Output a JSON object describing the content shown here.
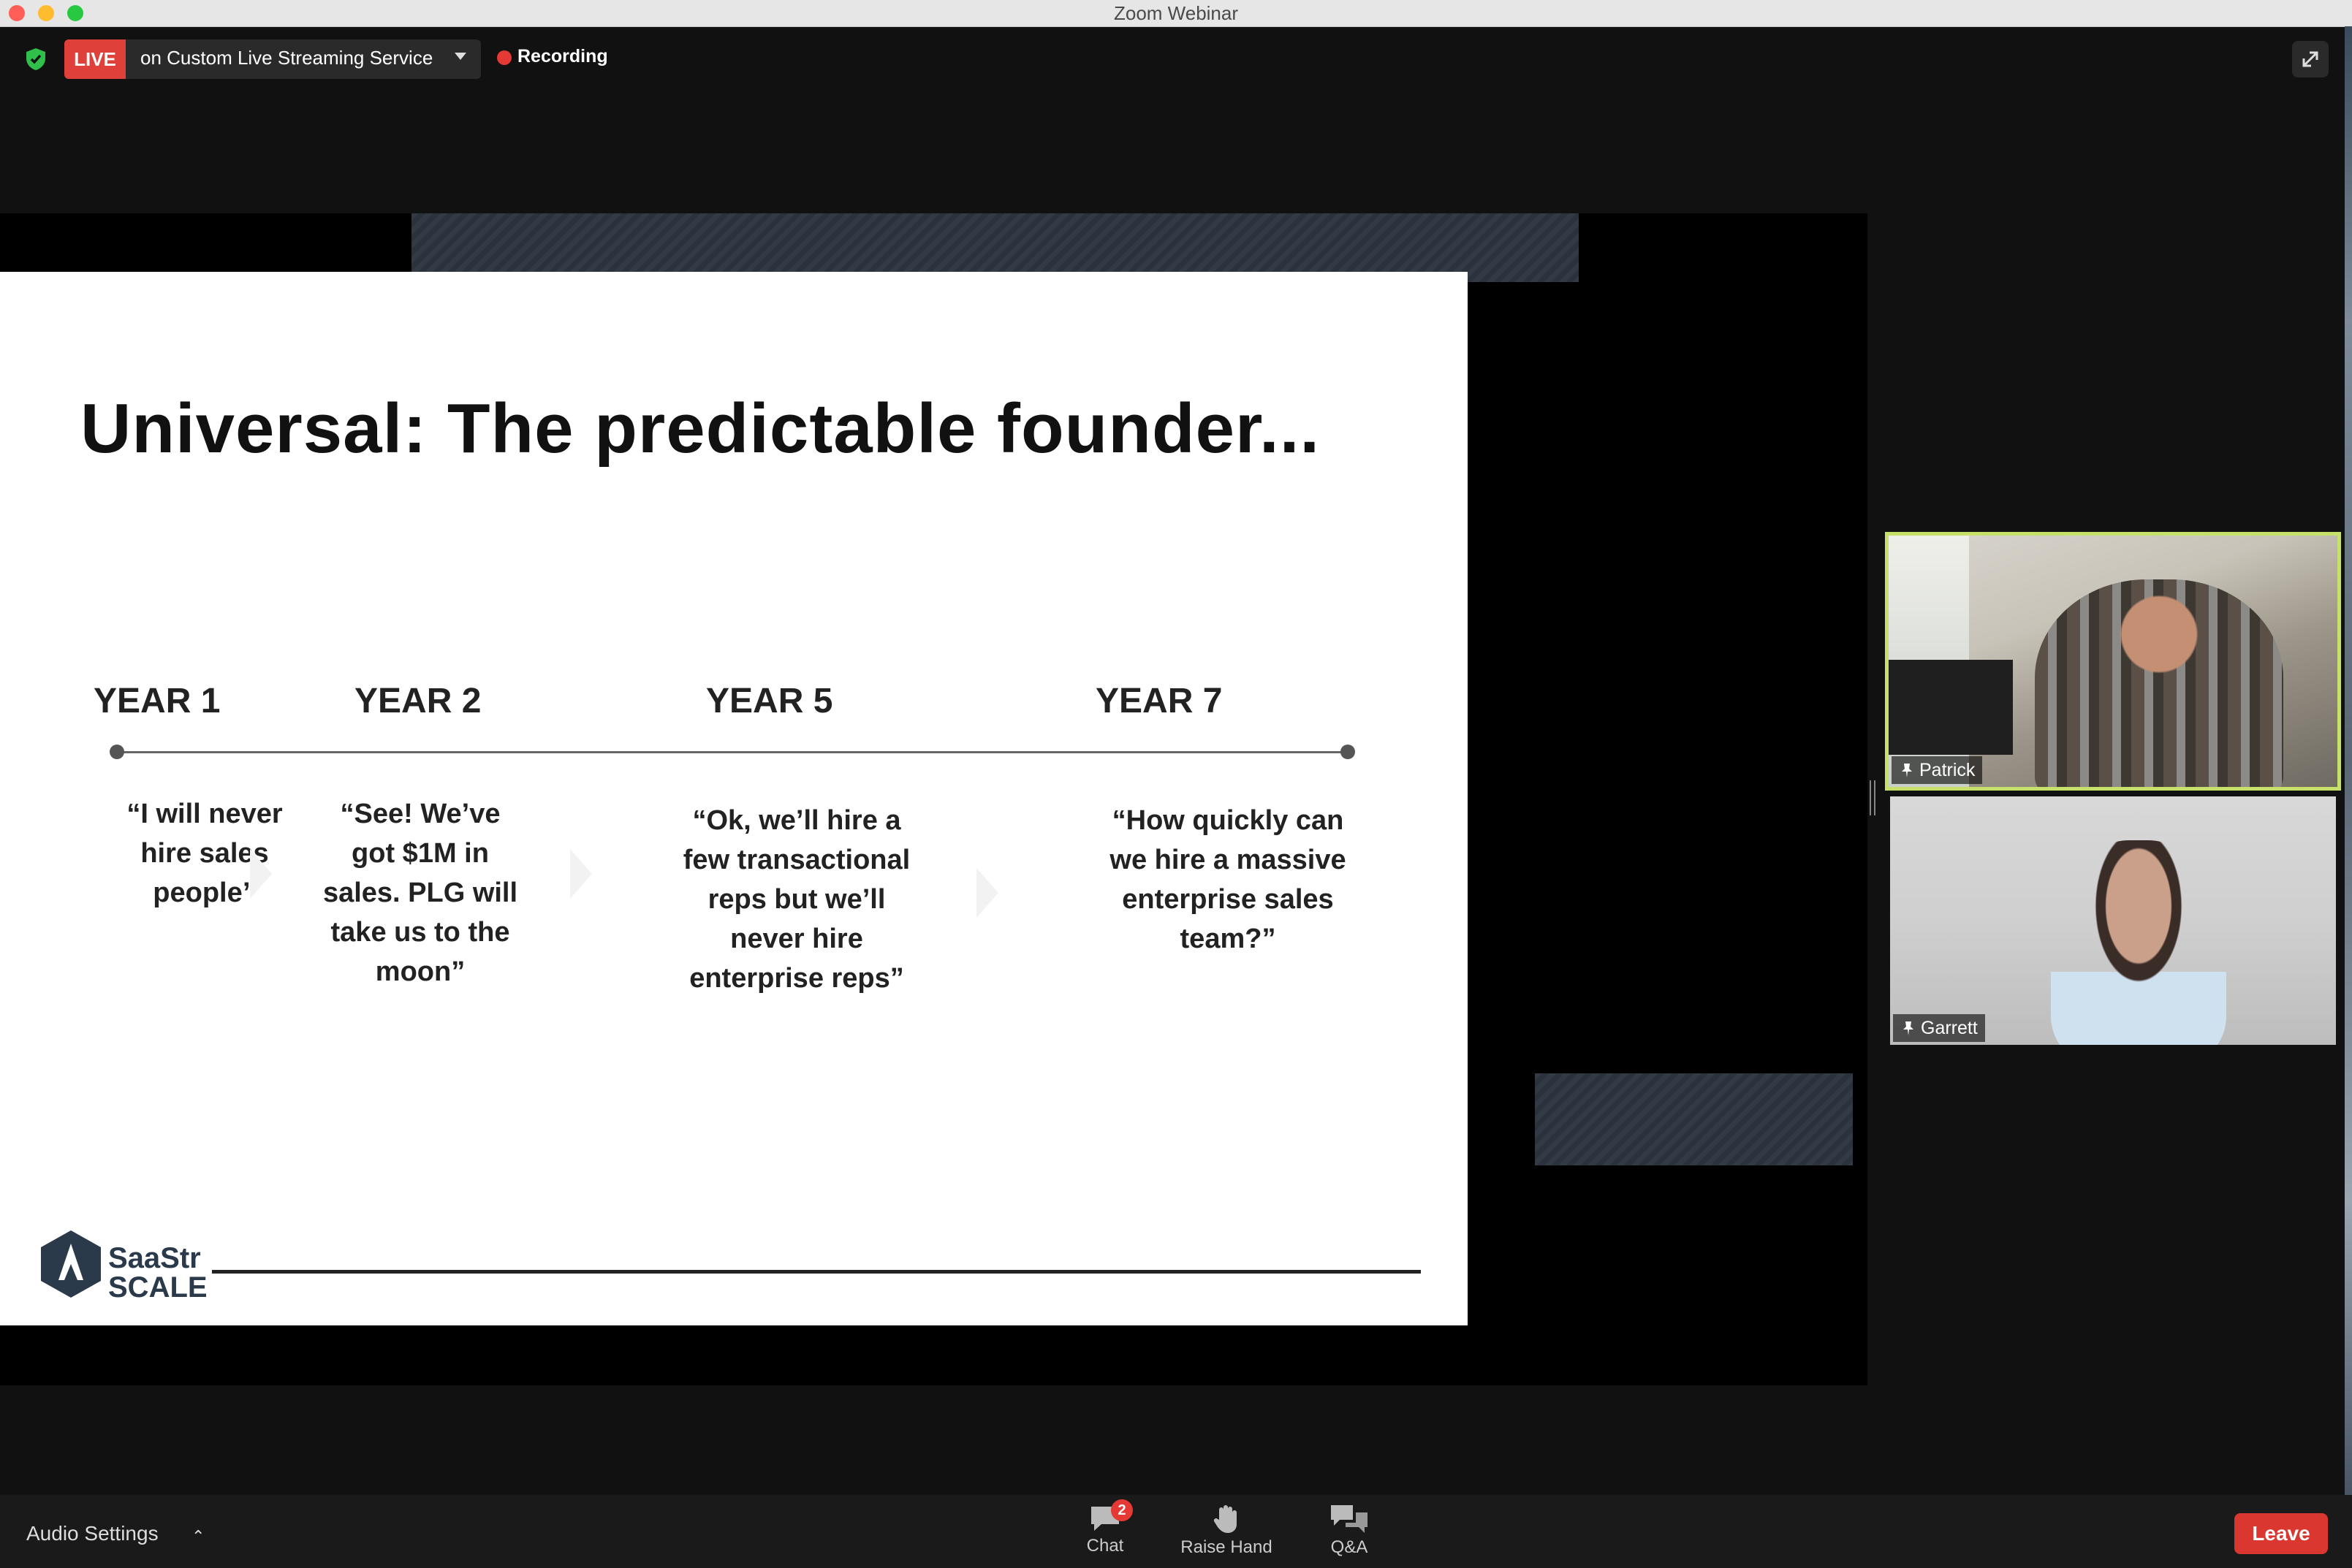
{
  "window": {
    "title": "Zoom Webinar"
  },
  "topbar": {
    "live_label": "LIVE",
    "stream_text": "on Custom Live Streaming Service",
    "recording_label": "Recording"
  },
  "slide": {
    "title": "Universal: The predictable founder...",
    "years": [
      "YEAR 1",
      "YEAR 2",
      "YEAR 5",
      "YEAR 7"
    ],
    "quotes": [
      "“I will never\nhire sales\npeople”",
      "“See!  We’ve\ngot $1M in\nsales. PLG will\ntake us to the\nmoon”",
      "“Ok, we’ll hire a\nfew transactional\nreps but we’ll\nnever hire\nenterprise reps”",
      "“How quickly can\nwe hire a massive\nenterprise sales\nteam?”"
    ],
    "logo_line1": "SaaStr",
    "logo_line2": "SCALE"
  },
  "participants": [
    {
      "name": "Patrick",
      "active": true
    },
    {
      "name": "Garrett",
      "active": false
    }
  ],
  "bottombar": {
    "audio_settings": "Audio Settings",
    "chat_label": "Chat",
    "chat_badge": "2",
    "raise_hand_label": "Raise Hand",
    "qa_label": "Q&A",
    "leave_label": "Leave"
  },
  "colors": {
    "live": "#e0403a",
    "recording": "#e53935",
    "active_speaker": "#c7e06a",
    "leave": "#d9372f"
  },
  "icons": [
    "shield-icon",
    "chevron-down-icon",
    "fullscreen-icon",
    "pin-icon",
    "chat-icon",
    "raise-hand-icon",
    "qa-icon",
    "chevron-up-icon"
  ]
}
